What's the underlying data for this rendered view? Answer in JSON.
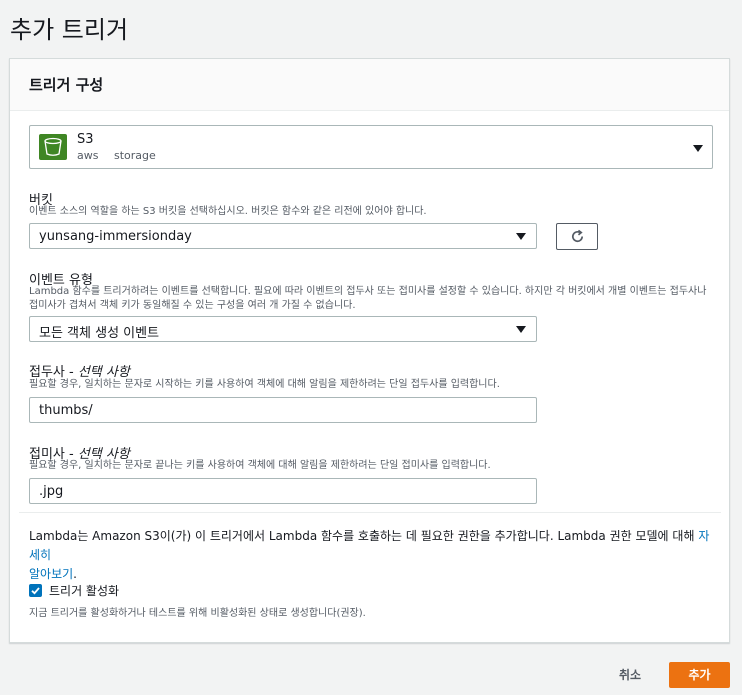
{
  "page": {
    "title": "추가 트리거"
  },
  "panel": {
    "title": "트리거 구성"
  },
  "trigger_source": {
    "name": "S3",
    "tags": [
      "aws",
      "storage"
    ],
    "logo_color": "#3f8624",
    "logo_icon": "bucket-icon"
  },
  "bucket": {
    "label": "버킷",
    "description": "이벤트 소스의 역할을 하는 S3 버킷을 선택하십시오. 버킷은 함수와 같은 리전에 있어야 합니다.",
    "value": "yunsang-immersionday",
    "refresh_icon": "refresh-icon"
  },
  "event_type": {
    "label": "이벤트 유형",
    "description_line1": "Lambda 함수를 트리거하려는 이벤트를 선택합니다. 필요에 따라 이벤트의 접두사 또는 접미사를 설정할 수 있습니다. 하지만 각 버킷에서 개별 이벤트는 접두사나",
    "description_line2": "접미사가 겹쳐서 객체 키가 동일해질 수 있는 구성을 여러 개 가질 수 없습니다.",
    "value": "모든 객체 생성 이벤트"
  },
  "prefix": {
    "label": "접두사 - ",
    "optional": "선택 사항",
    "description": "필요할 경우, 일치하는 문자로 시작하는 키를 사용하여 객체에 대해 알림을 제한하려는 단일 접두사를 입력합니다.",
    "value": "thumbs/"
  },
  "suffix": {
    "label": "접미사 - ",
    "optional": "선택 사항",
    "description": "필요할 경우, 일치하는 문자로 끝나는 키를 사용하여 객체에 대해 알림을 제한하려는 단일 접미사를 입력합니다.",
    "value": ".jpg"
  },
  "permission_info": {
    "text_line1": "Lambda는 Amazon S3이(가) 이 트리거에서 Lambda 함수를 호출하는 데 필요한 권한을 추가합니다. Lambda 권한 모델에 대해 ",
    "link_part1": "자세히",
    "link_part2": "알아보기",
    "text_end": "."
  },
  "enable_trigger": {
    "label": "트리거 활성화",
    "description": "지금 트리거를 활성화하거나 테스트를 위해 비활성화된 상태로 생성합니다(권장).",
    "checked": true
  },
  "actions": {
    "cancel": "취소",
    "add": "추가"
  },
  "colors": {
    "accent": "#ec7211",
    "link": "#0073bb",
    "checkbox": "#0073bb"
  }
}
